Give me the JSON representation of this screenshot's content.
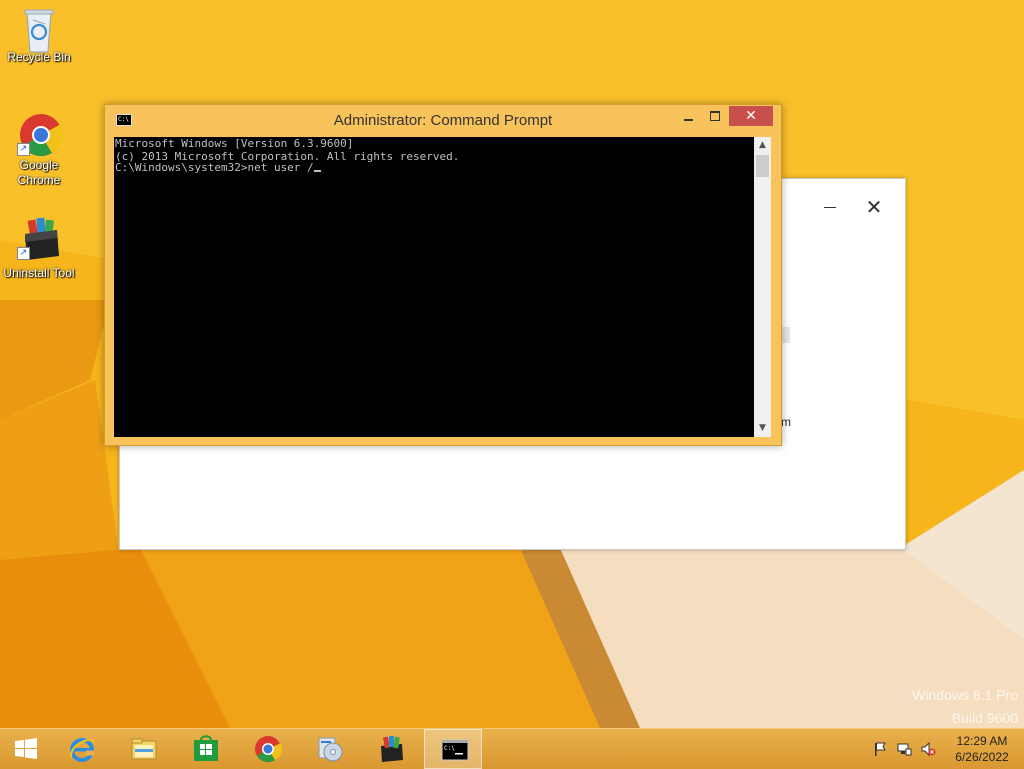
{
  "desktop": {
    "icons": [
      {
        "label": "Recycle Bin"
      },
      {
        "label": "Google Chrome"
      },
      {
        "label": "Uninstall Tool"
      }
    ],
    "watermark": {
      "line1": "Windows 8.1 Pro",
      "line2": "Build 9600"
    }
  },
  "bg_window": {
    "text_fragment": "m"
  },
  "cmd": {
    "title": "Administrator: Command Prompt",
    "sys_icon_text": "C:\\",
    "close_glyph": "✕",
    "console_lines": [
      "Microsoft Windows [Version 6.3.9600]",
      "(c) 2013 Microsoft Corporation. All rights reserved.",
      "",
      "C:\\Windows\\system32>net user /"
    ]
  },
  "taskbar": {
    "buttons": [
      {
        "icon": "windows-start-icon"
      },
      {
        "icon": "internet-explorer-icon"
      },
      {
        "icon": "file-explorer-icon"
      },
      {
        "icon": "windows-store-icon"
      },
      {
        "icon": "chrome-icon"
      },
      {
        "icon": "setup-disc-icon"
      },
      {
        "icon": "uninstall-tool-icon"
      },
      {
        "icon": "command-prompt-icon",
        "active": true
      }
    ],
    "clock": {
      "time": "12:29 AM",
      "date": "6/26/2022"
    }
  },
  "colors": {
    "wallpaper": "#f6b51b",
    "cmd_frame": "#f8c35a",
    "close_button": "#c7504c",
    "console_bg": "#000000",
    "console_text": "#c0c0c0"
  }
}
